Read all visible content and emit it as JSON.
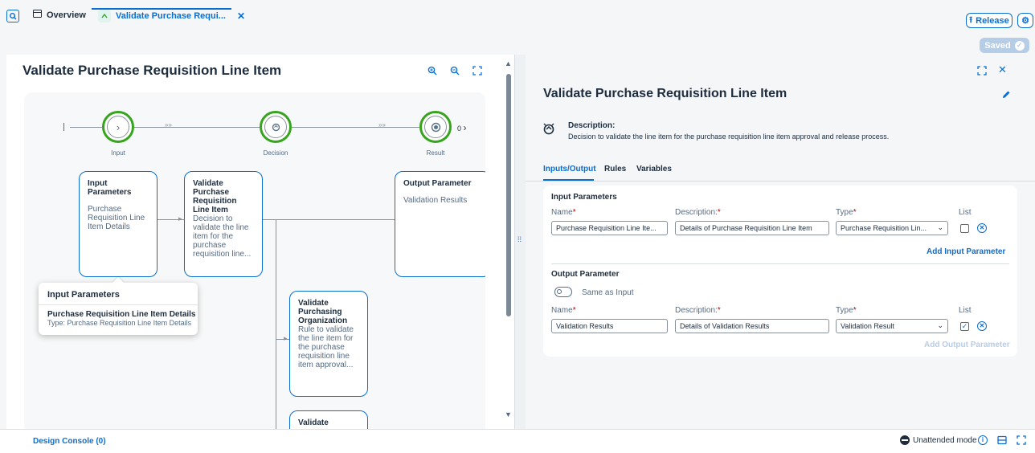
{
  "tabs": {
    "overview_label": "Overview",
    "active_label": "Validate Purchase Requi..."
  },
  "toolbar": {
    "release_label": "Release",
    "saved_label": "Saved"
  },
  "left": {
    "title": "Validate Purchase Requisition Line Item",
    "steps": [
      {
        "label": "Input"
      },
      {
        "label": "Decision"
      },
      {
        "label": "Result"
      }
    ],
    "step_counter": "0",
    "nodes": {
      "input_title": "Input Parameters",
      "input_body": "Purchase Requisition Line Item Details",
      "validate_title": "Validate Purchase Requisition Line Item",
      "validate_body": "Decision to validate the line item for the purchase requisition line...",
      "output_title": "Output Parameter",
      "output_body": "Validation Results",
      "org_title": "Validate Purchasing Organization",
      "org_body": "Rule to validate the line item for the purchase requisition line item approval...",
      "bottom_title": "Validate"
    },
    "popover": {
      "title": "Input Parameters",
      "item_title": "Purchase Requisition Line Item Details",
      "item_type": "Type: Purchase Requisition Line Item Details"
    }
  },
  "right": {
    "title": "Validate Purchase Requisition Line Item",
    "description_label": "Description:",
    "description": "Decision to validate the line item for the purchase requisition line item approval and release process.",
    "tabs": [
      "Inputs/Output",
      "Rules",
      "Variables"
    ],
    "input_section": "Input Parameters",
    "col_name": "Name",
    "col_description": "Description:",
    "col_type": "Type",
    "col_list": "List",
    "required_mark": "*",
    "input_row": {
      "name": "Purchase Requisition Line Ite...",
      "description": "Details of Purchase Requisition Line Item",
      "type": "Purchase Requisition Lin...",
      "list_checked": false
    },
    "add_input_label": "Add Input Parameter",
    "output_section": "Output Parameter",
    "same_as_input_label": "Same as Input",
    "output_row": {
      "name": "Validation Results",
      "description": "Details of Validation Results",
      "type": "Validation Result",
      "list_checked": true
    },
    "add_output_label": "Add Output Parameter"
  },
  "footer": {
    "console_label": "Design Console (0)",
    "mode_label": "Unattended mode"
  },
  "colors": {
    "accent": "#0a6ed1",
    "success": "#36a41d",
    "saved_bg": "#b6cde8"
  }
}
